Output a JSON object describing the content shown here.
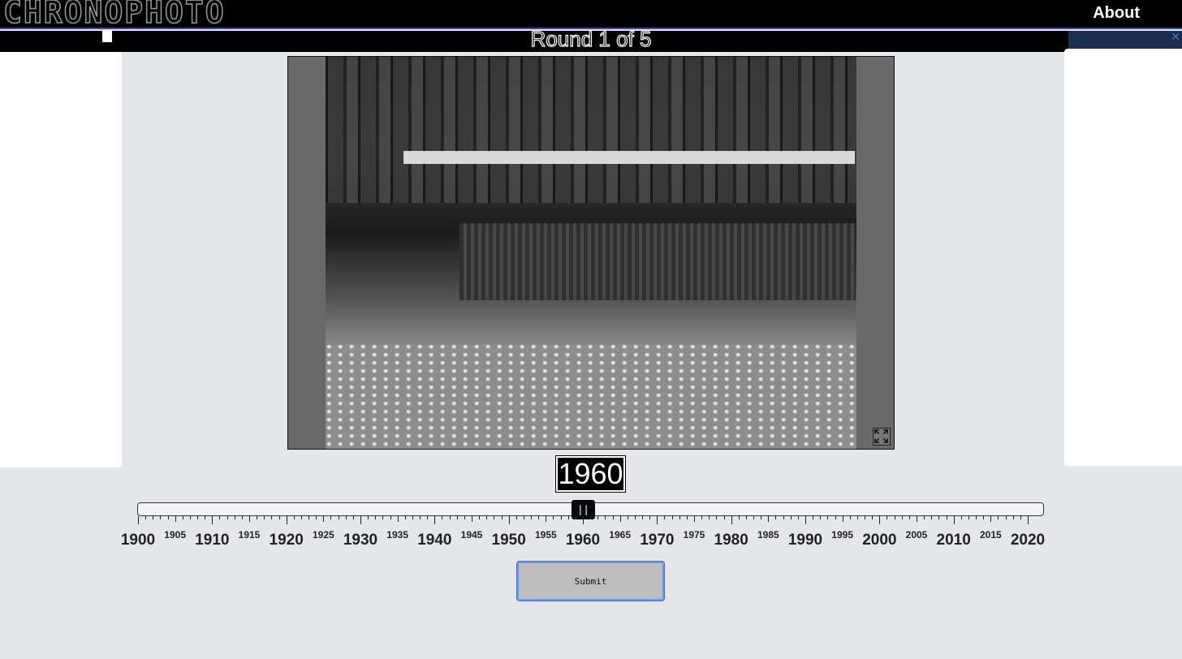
{
  "header": {
    "logo_text": "CHRONOPHOTO",
    "about_label": "About"
  },
  "round": {
    "text": "Round 1 of 5"
  },
  "guess": {
    "year_display": "1960",
    "slider_value": 1960,
    "slider_min": 1900,
    "slider_max": 2020
  },
  "timeline": {
    "major_labels": [
      "1900",
      "1910",
      "1920",
      "1930",
      "1940",
      "1950",
      "1960",
      "1970",
      "1980",
      "1990",
      "2000",
      "2010",
      "2020"
    ],
    "minor_labels": [
      "1905",
      "1915",
      "1925",
      "1935",
      "1945",
      "1955",
      "1965",
      "1975",
      "1985",
      "1995",
      "2005",
      "2015"
    ]
  },
  "actions": {
    "submit_label": "Submit"
  },
  "icons": {
    "expand": "expand-icon",
    "ad_close": "close-icon"
  },
  "colors": {
    "topbar": "#000000",
    "page_background": "#e6e7ea",
    "submit_border": "#6c9ae8"
  }
}
